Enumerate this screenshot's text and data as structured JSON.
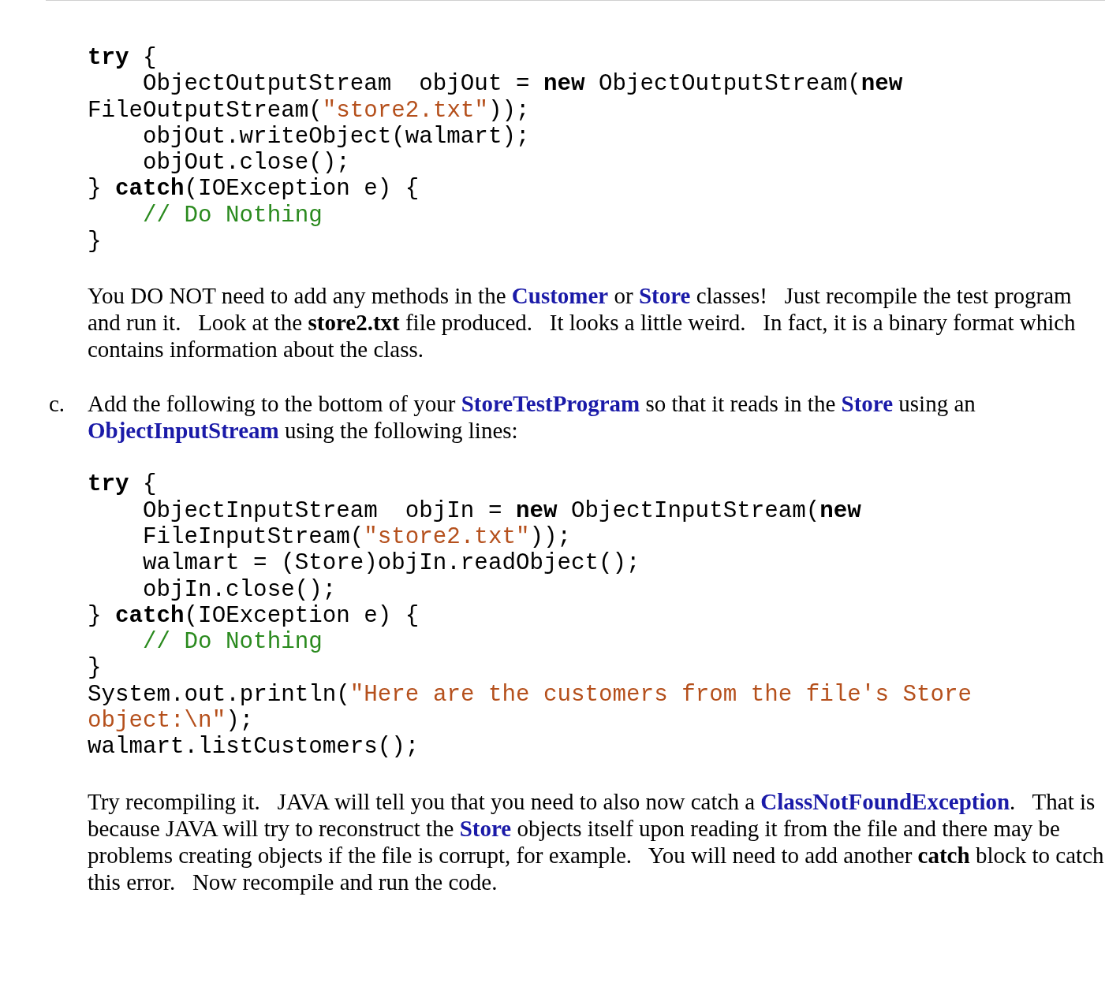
{
  "blocks": [
    {
      "kind": "code",
      "lines": [
        {
          "indented": false,
          "segments": [
            {
              "kind": "keyword",
              "text": "try"
            },
            {
              "kind": "plain",
              "text": " {"
            }
          ]
        },
        {
          "indented": true,
          "segments": [
            {
              "kind": "plain",
              "text": "ObjectOutputStream  objOut = "
            },
            {
              "kind": "keyword",
              "text": "new"
            },
            {
              "kind": "plain",
              "text": " ObjectOutputStream("
            },
            {
              "kind": "keyword",
              "text": "new"
            }
          ]
        },
        {
          "indented": false,
          "segments": [
            {
              "kind": "plain",
              "text": "FileOutputStream("
            },
            {
              "kind": "string",
              "text": "\"store2.txt\""
            },
            {
              "kind": "plain",
              "text": "));"
            }
          ]
        },
        {
          "indented": true,
          "segments": [
            {
              "kind": "plain",
              "text": "objOut.writeObject(walmart);"
            }
          ]
        },
        {
          "indented": true,
          "segments": [
            {
              "kind": "plain",
              "text": "objOut.close();"
            }
          ]
        },
        {
          "indented": false,
          "segments": [
            {
              "kind": "plain",
              "text": "} "
            },
            {
              "kind": "keyword",
              "text": "catch"
            },
            {
              "kind": "plain",
              "text": "(IOException e) {"
            }
          ]
        },
        {
          "indented": true,
          "segments": [
            {
              "kind": "comment",
              "text": "// Do Nothing"
            }
          ]
        },
        {
          "indented": false,
          "segments": [
            {
              "kind": "plain",
              "text": "}"
            }
          ]
        }
      ]
    },
    {
      "kind": "paragraph",
      "segments": [
        {
          "kind": "plain",
          "text": "You DO NOT need to add any methods in the "
        },
        {
          "kind": "class",
          "text": "Customer"
        },
        {
          "kind": "plain",
          "text": " or "
        },
        {
          "kind": "class",
          "text": "Store"
        },
        {
          "kind": "plain",
          "text": " classes!   Just recompile the test program and run it.   Look at the "
        },
        {
          "kind": "bold",
          "text": "store2.txt"
        },
        {
          "kind": "plain",
          "text": " file produced.   It looks a little weird.   In fact, it is a binary format which contains information about the class."
        }
      ]
    },
    {
      "kind": "list_item",
      "marker": "c.",
      "segments": [
        {
          "kind": "plain",
          "text": "Add the following to the bottom of your "
        },
        {
          "kind": "class",
          "text": "StoreTestProgram"
        },
        {
          "kind": "plain",
          "text": " so that it reads in the "
        },
        {
          "kind": "class",
          "text": "Store"
        },
        {
          "kind": "plain",
          "text": " using an "
        },
        {
          "kind": "class",
          "text": "ObjectInputStream"
        },
        {
          "kind": "plain",
          "text": " using the following lines:"
        }
      ]
    },
    {
      "kind": "code",
      "lines": [
        {
          "indented": false,
          "segments": [
            {
              "kind": "keyword",
              "text": "try"
            },
            {
              "kind": "plain",
              "text": " {"
            }
          ]
        },
        {
          "indented": true,
          "segments": [
            {
              "kind": "plain",
              "text": "ObjectInputStream  objIn = "
            },
            {
              "kind": "keyword",
              "text": "new"
            },
            {
              "kind": "plain",
              "text": " ObjectInputStream("
            },
            {
              "kind": "keyword",
              "text": "new"
            }
          ]
        },
        {
          "indented": true,
          "segments": [
            {
              "kind": "plain",
              "text": "FileInputStream("
            },
            {
              "kind": "string",
              "text": "\"store2.txt\""
            },
            {
              "kind": "plain",
              "text": "));"
            }
          ]
        },
        {
          "indented": true,
          "segments": [
            {
              "kind": "plain",
              "text": "walmart = (Store)objIn.readObject();"
            }
          ]
        },
        {
          "indented": true,
          "segments": [
            {
              "kind": "plain",
              "text": "objIn.close();"
            }
          ]
        },
        {
          "indented": false,
          "segments": [
            {
              "kind": "plain",
              "text": "} "
            },
            {
              "kind": "keyword",
              "text": "catch"
            },
            {
              "kind": "plain",
              "text": "(IOException e) {"
            }
          ]
        },
        {
          "indented": true,
          "segments": [
            {
              "kind": "comment",
              "text": "// Do Nothing"
            }
          ]
        },
        {
          "indented": false,
          "segments": [
            {
              "kind": "plain",
              "text": "}"
            }
          ]
        },
        {
          "indented": false,
          "segments": [
            {
              "kind": "plain",
              "text": "System.out.println("
            },
            {
              "kind": "string",
              "text": "\"Here are the customers from the file's Store"
            }
          ]
        },
        {
          "indented": false,
          "segments": [
            {
              "kind": "string",
              "text": "object:\\n\""
            },
            {
              "kind": "plain",
              "text": ");"
            }
          ]
        },
        {
          "indented": false,
          "segments": [
            {
              "kind": "plain",
              "text": "walmart.listCustomers();"
            }
          ]
        }
      ]
    },
    {
      "kind": "paragraph",
      "segments": [
        {
          "kind": "plain",
          "text": "Try recompiling it.   JAVA will tell you that you need to also now catch a "
        },
        {
          "kind": "class",
          "text": "ClassNotFoundException"
        },
        {
          "kind": "plain",
          "text": ".   That is because JAVA will try to reconstruct the "
        },
        {
          "kind": "class",
          "text": "Store"
        },
        {
          "kind": "plain",
          "text": " objects itself upon reading it from the file and there may be problems creating objects if the file is corrupt, for example.   You will need to add another "
        },
        {
          "kind": "bold",
          "text": "catch"
        },
        {
          "kind": "plain",
          "text": " block to catch this error.   Now recompile and run the code."
        }
      ]
    }
  ]
}
